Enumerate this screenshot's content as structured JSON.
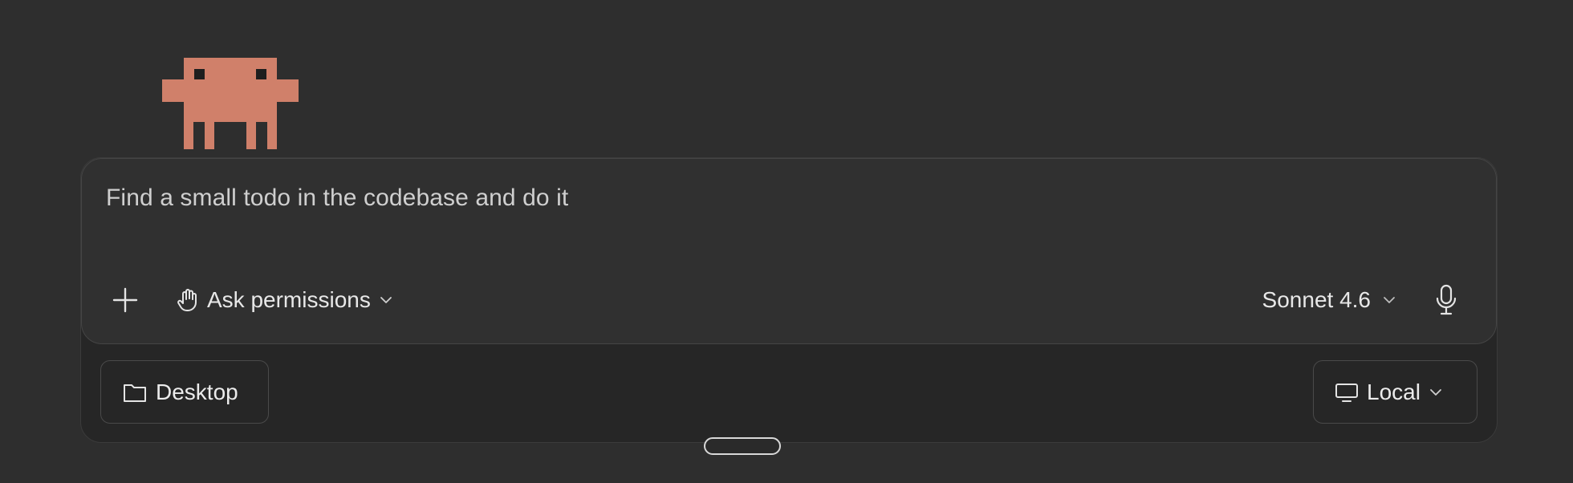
{
  "composer": {
    "prompt_text": "Find a small todo in the codebase and do it",
    "permission_label": "Ask permissions",
    "model_label": "Sonnet 4.6"
  },
  "footer": {
    "folder_label": "Desktop",
    "environment_label": "Local"
  },
  "icons": {
    "mascot": "pixel-creature-icon",
    "add": "plus-icon",
    "permission": "hand-icon",
    "dropdown": "chevron-down-icon",
    "mic": "microphone-icon",
    "folder": "folder-icon",
    "monitor": "monitor-icon"
  },
  "colors": {
    "background": "#2e2e2e",
    "mascot": "#d0806a",
    "composer": "#303030"
  }
}
